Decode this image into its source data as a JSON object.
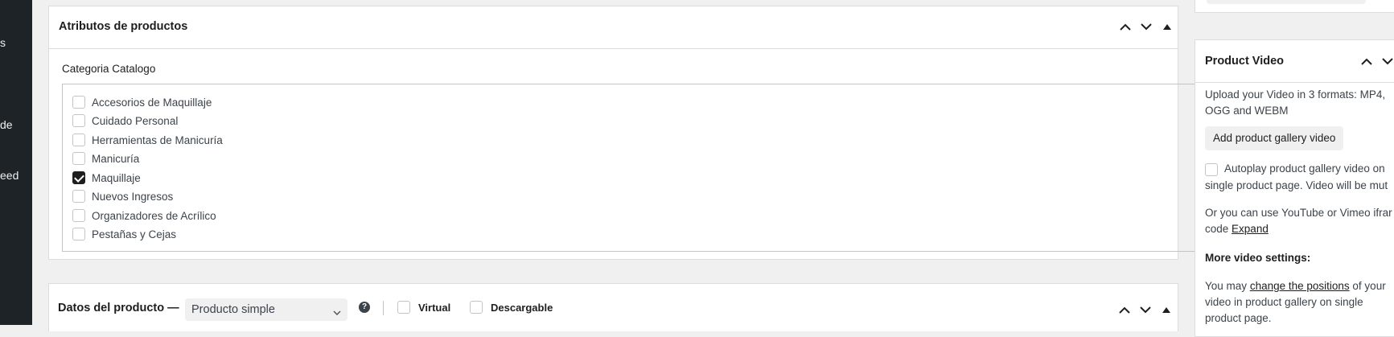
{
  "sidebar": {
    "fragments": [
      "s",
      "de",
      "eed"
    ]
  },
  "atributos": {
    "title": "Atributos de productos",
    "category_label": "Categoria Catalogo",
    "categories": [
      {
        "label": "Accesorios de Maquillaje",
        "checked": false
      },
      {
        "label": "Cuidado Personal",
        "checked": false
      },
      {
        "label": "Herramientas de Manicuría",
        "checked": false
      },
      {
        "label": "Manicuría",
        "checked": false
      },
      {
        "label": "Maquillaje",
        "checked": true
      },
      {
        "label": "Nuevos Ingresos",
        "checked": false
      },
      {
        "label": "Organizadores de Acrílico",
        "checked": false
      },
      {
        "label": "Pestañas y Cejas",
        "checked": false
      }
    ]
  },
  "datos": {
    "title": "Datos del producto —",
    "product_type": "Producto simple",
    "help": "?",
    "virtual_label": "Virtual",
    "descargable_label": "Descargable"
  },
  "product_video": {
    "title": "Product Video",
    "upload_line1": "Upload your Video in 3 formats: MP4,",
    "upload_line2": "OGG and WEBM",
    "add_button": "Add product gallery video",
    "autoplay_line1": "Autoplay product gallery video on",
    "autoplay_line2": "single product page. Video will be mut",
    "iframe_line1": "Or you can use YouTube or Vimeo ifrar",
    "iframe_line2_prefix": "code",
    "expand_link": "Expand",
    "more_settings": "More video settings:",
    "positions_prefix": "You may",
    "positions_link": "change the positions",
    "positions_suffix": "of your",
    "positions_line2": "video in product gallery on single",
    "positions_line3": "product page."
  },
  "icons": [
    "chevron-up-icon",
    "chevron-down-icon",
    "triangle-up-icon",
    "chevron-down-icon",
    "checkmark-icon",
    "help-icon"
  ]
}
